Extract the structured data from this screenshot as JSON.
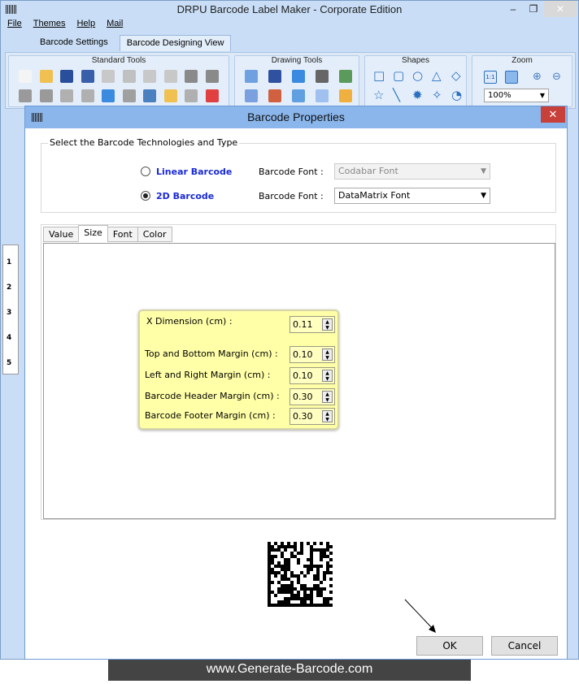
{
  "app": {
    "title": "DRPU Barcode Label Maker - Corporate Edition",
    "window_controls": {
      "minimize": "–",
      "restore": "❐",
      "close": "✕"
    }
  },
  "menu": [
    "File",
    "Themes",
    "Help",
    "Mail"
  ],
  "tabs": [
    "Barcode Settings",
    "Barcode Designing View"
  ],
  "ribbon": {
    "groups": [
      "Standard Tools",
      "Drawing Tools",
      "Shapes",
      "Zoom"
    ],
    "zoom_value": "100%",
    "zoom_fit_label": "1:1"
  },
  "ruler": [
    "1",
    "2",
    "3",
    "4",
    "5"
  ],
  "dialog": {
    "title": "Barcode Properties",
    "close": "✕",
    "section_title": "Select the Barcode Technologies and Type",
    "linear": {
      "label": "Linear Barcode",
      "font_label": "Barcode Font :",
      "font_value": "Codabar Font",
      "selected": false
    },
    "twod": {
      "label": "2D Barcode",
      "font_label": "Barcode Font :",
      "font_value": "DataMatrix Font",
      "selected": true
    },
    "tabs": [
      "Value",
      "Size",
      "Font",
      "Color"
    ],
    "active_tab": "Size",
    "size_fields": [
      {
        "label": "X Dimension (cm) :",
        "value": "0.11"
      },
      {
        "label": "Top and Bottom Margin (cm) :",
        "value": "0.10"
      },
      {
        "label": "Left and Right Margin (cm) :",
        "value": "0.10"
      },
      {
        "label": "Barcode Header Margin (cm) :",
        "value": "0.30"
      },
      {
        "label": "Barcode Footer Margin (cm) :",
        "value": "0.30"
      }
    ],
    "ok": "OK",
    "cancel": "Cancel"
  },
  "footer": "www.Generate-Barcode.com"
}
